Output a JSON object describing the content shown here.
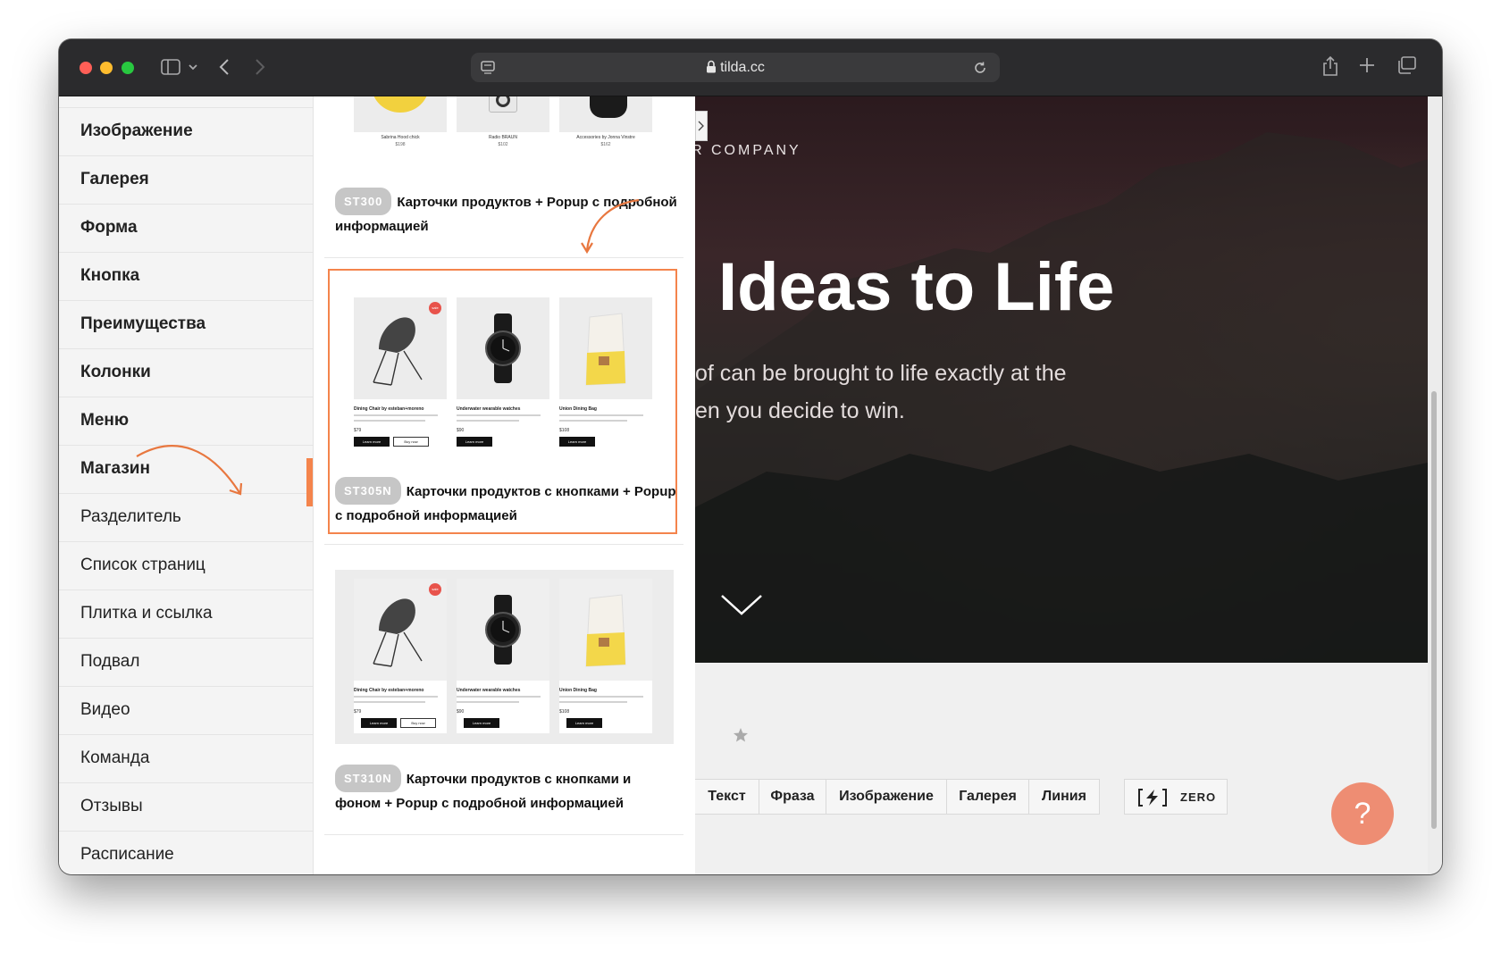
{
  "browser": {
    "url": "tilda.cc"
  },
  "sidebar": {
    "items": [
      {
        "label": "Изображение"
      },
      {
        "label": "Галерея"
      },
      {
        "label": "Форма"
      },
      {
        "label": "Кнопка"
      },
      {
        "label": "Преимущества"
      },
      {
        "label": "Колонки"
      },
      {
        "label": "Меню"
      },
      {
        "label": "Магазин"
      },
      {
        "label": "Разделитель"
      },
      {
        "label": "Список страниц"
      },
      {
        "label": "Плитка и ссылка"
      },
      {
        "label": "Подвал"
      },
      {
        "label": "Видео"
      },
      {
        "label": "Команда"
      },
      {
        "label": "Отзывы"
      },
      {
        "label": "Расписание"
      }
    ],
    "active": "Магазин"
  },
  "blocks": [
    {
      "code": "ST300",
      "title": "Карточки продуктов + Popup с подробной информацией",
      "products": [
        {
          "name": "Sabrina Hood chick",
          "price": "$198"
        },
        {
          "name": "Radio BRAUN",
          "price": "$102"
        },
        {
          "name": "Accessories by Jonna Vinstre",
          "price": "$162"
        }
      ]
    },
    {
      "code": "ST305N",
      "title": "Карточки продуктов с кнопками + Popup с подробной информацией",
      "products": [
        {
          "name": "Dining Chair by esteban+moreno",
          "price": "$79",
          "buttons": [
            "Learn more",
            "Buy now"
          ],
          "sale": "sale"
        },
        {
          "name": "Underwater wearable watches",
          "price": "$90",
          "buttons": [
            "Learn more"
          ]
        },
        {
          "name": "Union Dining Bag",
          "price": "$108",
          "buttons": [
            "Learn more"
          ]
        }
      ]
    },
    {
      "code": "ST310N",
      "title": "Карточки продуктов с кнопками и фоном + Popup с подробной информацией",
      "products": [
        {
          "name": "Dining Chair by esteban+moreno",
          "price": "$79",
          "buttons": [
            "Learn more",
            "Buy now"
          ],
          "sale": "sale"
        },
        {
          "name": "Underwater wearable watches",
          "price": "$90",
          "buttons": [
            "Learn more"
          ]
        },
        {
          "name": "Union Dining Bag",
          "price": "$108",
          "buttons": [
            "Learn more"
          ]
        }
      ]
    }
  ],
  "preview": {
    "company": "R COMPANY",
    "title": "Ideas to Life",
    "subtitle_line1": "of can be brought to life exactly at the",
    "subtitle_line2": "en you decide to win.",
    "toolbar": [
      "Текст",
      "Фраза",
      "Изображение",
      "Галерея",
      "Линия"
    ],
    "zero_label": "ZERO",
    "help": "?"
  },
  "colors": {
    "accent": "#f4844c",
    "help_button": "#ee8d73",
    "sale_dot": "#e8534b"
  }
}
